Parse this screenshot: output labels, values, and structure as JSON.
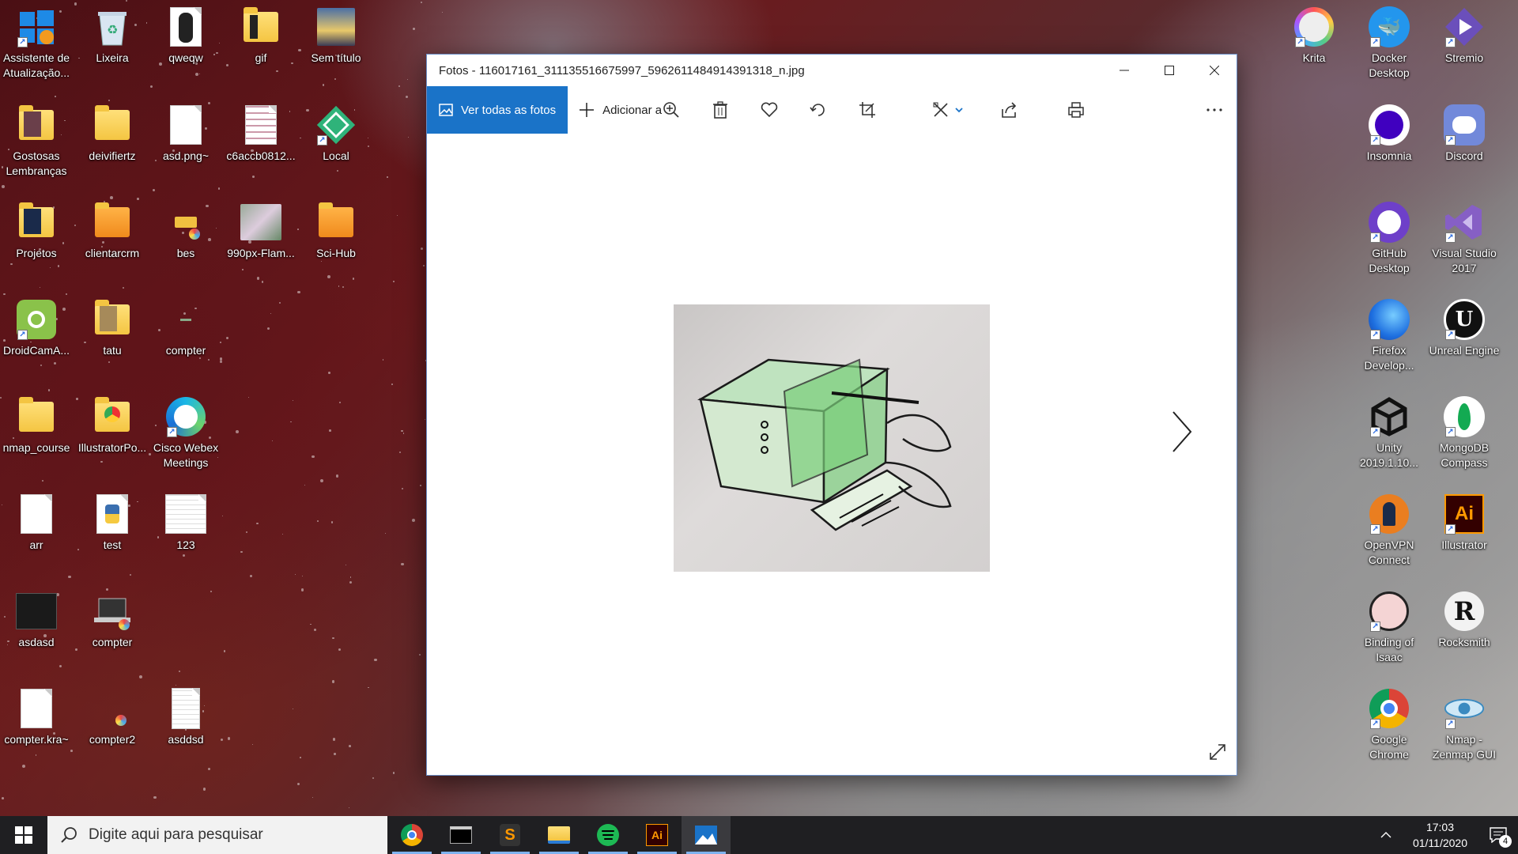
{
  "desktop": {
    "left_icons": [
      {
        "label": "Assistente de Atualização...",
        "icon": "windows-update-icon"
      },
      {
        "label": "Lixeira",
        "icon": "recycle-bin-icon"
      },
      {
        "label": "qweqw",
        "icon": "image-file-icon"
      },
      {
        "label": "gif",
        "icon": "folder-icon"
      },
      {
        "label": "Sem título",
        "icon": "image-file-icon"
      },
      {
        "label": "Gostosas Lembranças",
        "icon": "folder-icon"
      },
      {
        "label": "deivifiertz",
        "icon": "folder-icon"
      },
      {
        "label": "asd.png~",
        "icon": "document-icon"
      },
      {
        "label": "c6accb0812...",
        "icon": "image-file-icon"
      },
      {
        "label": "Local",
        "icon": "local-app-icon"
      },
      {
        "label": "Projetos",
        "icon": "folder-icon"
      },
      {
        "label": "clientarcrm",
        "icon": "folder-icon"
      },
      {
        "label": "bes",
        "icon": "krita-file-icon"
      },
      {
        "label": "990px-Flam...",
        "icon": "image-file-icon"
      },
      {
        "label": "Sci-Hub",
        "icon": "folder-icon"
      },
      {
        "label": "DroidCamA...",
        "icon": "android-icon"
      },
      {
        "label": "tatu",
        "icon": "folder-icon"
      },
      {
        "label": "compter",
        "icon": "generic-file-icon"
      },
      {
        "label": "nmap_course",
        "icon": "folder-icon"
      },
      {
        "label": "IllustratorPo...",
        "icon": "folder-icon"
      },
      {
        "label": "Cisco Webex Meetings",
        "icon": "webex-icon"
      },
      {
        "label": "arr",
        "icon": "document-icon"
      },
      {
        "label": "test",
        "icon": "python-file-icon"
      },
      {
        "label": "123",
        "icon": "text-file-icon"
      },
      {
        "label": "asdasd",
        "icon": "terminal-file-icon"
      },
      {
        "label": "compter",
        "icon": "laptop-icon"
      },
      {
        "label": "compter.kra~",
        "icon": "document-icon"
      },
      {
        "label": "compter2",
        "icon": "krita-file-icon"
      },
      {
        "label": "asddsd",
        "icon": "text-file-icon"
      }
    ],
    "right_icons": [
      {
        "label": "Krita",
        "icon": "krita-icon"
      },
      {
        "label": "Docker Desktop",
        "icon": "docker-icon"
      },
      {
        "label": "Stremio",
        "icon": "stremio-icon"
      },
      {
        "label": "Insomnia",
        "icon": "insomnia-icon"
      },
      {
        "label": "Discord",
        "icon": "discord-icon"
      },
      {
        "label": "GitHub Desktop",
        "icon": "github-icon"
      },
      {
        "label": "Visual Studio 2017",
        "icon": "visual-studio-icon"
      },
      {
        "label": "Firefox Develop...",
        "icon": "firefox-icon"
      },
      {
        "label": "Unreal Engine",
        "icon": "unreal-icon"
      },
      {
        "label": "Unity 2019.1.10...",
        "icon": "unity-icon"
      },
      {
        "label": "MongoDB Compass",
        "icon": "mongodb-icon"
      },
      {
        "label": "OpenVPN Connect",
        "icon": "openvpn-icon"
      },
      {
        "label": "Illustrator",
        "icon": "illustrator-icon"
      },
      {
        "label": "Binding of Isaac",
        "icon": "isaac-icon"
      },
      {
        "label": "Rocksmith",
        "icon": "rocksmith-icon"
      },
      {
        "label": "Google Chrome",
        "icon": "chrome-icon"
      },
      {
        "label": "Nmap - Zenmap GUI",
        "icon": "nmap-icon"
      }
    ]
  },
  "photos_window": {
    "title": "Fotos - 116017161_311135516675997_5962611484914391318_n.jpg",
    "toolbar": {
      "all_photos_label": "Ver todas as fotos",
      "add_to_label": "Adicionar a"
    },
    "icons": [
      "zoom-in-icon",
      "delete-icon",
      "favorite-icon",
      "rotate-icon",
      "crop-icon",
      "edit-icon",
      "share-icon",
      "print-icon",
      "more-icon"
    ]
  },
  "taskbar": {
    "search_placeholder": "Digite aqui para pesquisar",
    "apps": [
      "chrome",
      "terminal",
      "sublime-text",
      "file-explorer",
      "spotify",
      "illustrator",
      "photos"
    ],
    "time": "17:03",
    "date": "01/11/2020",
    "notification_count": "4"
  },
  "colors": {
    "accent": "#1a73c8",
    "taskbar": "#1f1f22"
  }
}
